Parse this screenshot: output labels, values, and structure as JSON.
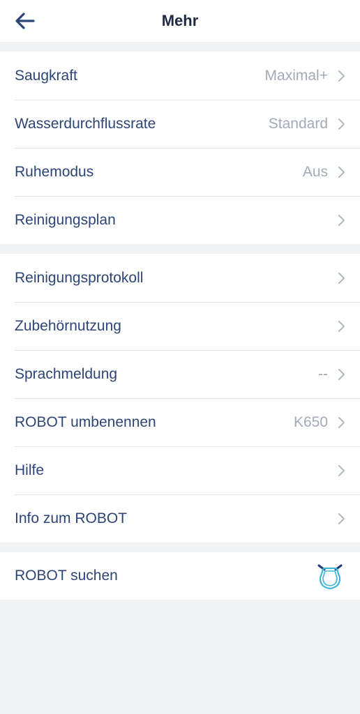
{
  "header": {
    "title": "Mehr"
  },
  "sections": [
    {
      "items": [
        {
          "label": "Saugkraft",
          "value": "Maximal+"
        },
        {
          "label": "Wasserdurchflussrate",
          "value": "Standard"
        },
        {
          "label": "Ruhemodus",
          "value": "Aus"
        },
        {
          "label": "Reinigungsplan",
          "value": ""
        }
      ]
    },
    {
      "items": [
        {
          "label": "Reinigungsprotokoll",
          "value": ""
        },
        {
          "label": "Zubehörnutzung",
          "value": ""
        },
        {
          "label": "Sprachmeldung",
          "value": "--"
        },
        {
          "label": "ROBOT umbenennen",
          "value": "K650"
        },
        {
          "label": "Hilfe",
          "value": ""
        },
        {
          "label": "Info zum ROBOT",
          "value": ""
        }
      ]
    }
  ],
  "find_robot": {
    "label": "ROBOT suchen"
  },
  "colors": {
    "accent": "#2c4576",
    "value_gray": "#a2a9b7",
    "robot_icon": "#3fb6d6",
    "robot_icon_dark": "#1f3a78"
  }
}
